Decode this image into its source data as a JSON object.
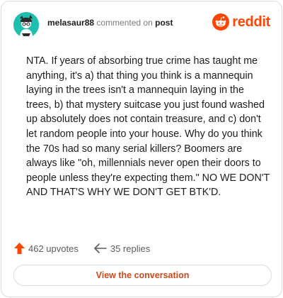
{
  "header": {
    "username": "melasaur88",
    "verb": "commented on",
    "target": "post",
    "brand": "reddit"
  },
  "comment": {
    "text": "NTA. If years of absorbing true crime has taught me anything, it's a) that thing you think is a mannequin laying in the trees isn't a mannequin laying in the trees, b) that mystery suitcase you just found washed up absolutely does not contain treasure, and c) don't let random people into your house. Why do you think the 70s had so many serial killers? Boomers are always like \"oh, millennials never open their doors to people unless they're expecting them.\" NO WE DON'T AND THAT'S WHY WE DON'T GET BTK'D."
  },
  "stats": {
    "upvotes": "462 upvotes",
    "replies": "35 replies"
  },
  "cta": {
    "label": "View the conversation"
  },
  "colors": {
    "brand": "#ff4500",
    "cta_text": "#cc4a1a",
    "avatar_bg": "#1fbfb0"
  },
  "icons": [
    "avatar",
    "reddit-logo-icon",
    "upvote-arrow-icon",
    "reply-arrow-icon"
  ]
}
